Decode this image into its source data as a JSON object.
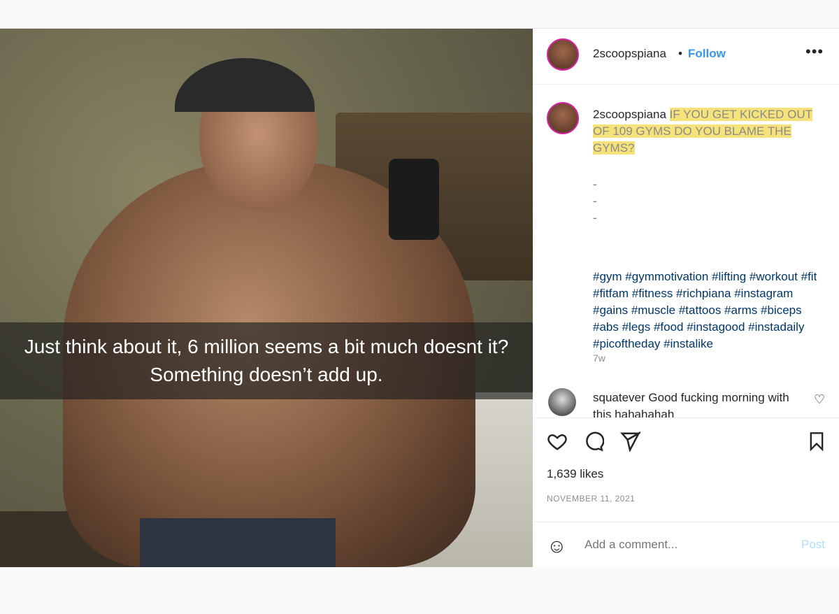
{
  "overlay": {
    "caption": "Just think about it, 6 million seems a bit much doesnt it? Something doesn’t add up."
  },
  "header": {
    "username": "2scoopspiana",
    "separator": "•",
    "follow_label": "Follow",
    "more_icon": "more-horizontal-icon"
  },
  "caption": {
    "username": "2scoopspiana",
    "text": "IF YOU GET KICKED OUT OF 109 GYMS DO YOU BLAME THE GYMS?",
    "dashes": [
      "-",
      "-",
      "-"
    ],
    "hashtags": "#gym #gymmotivation #lifting #workout #fit #fitfam #fitness #richpiana #instagram #gains #muscle #tattoos #arms #biceps #abs #legs #food #instagood #instadaily #picoftheday #instalike",
    "age": "7w"
  },
  "comment": {
    "username": "squatever",
    "text": "Good fucking morning with this hahahahah"
  },
  "actions": {
    "like_icon": "heart-icon",
    "comment_icon": "comment-icon",
    "share_icon": "send-icon",
    "save_icon": "bookmark-icon",
    "likes": "1,639 likes",
    "date": "NOVEMBER 11, 2021"
  },
  "add_comment": {
    "placeholder": "Add a comment...",
    "post_label": "Post"
  },
  "colors": {
    "accent": "#3897f0",
    "highlight": "#f6e27a",
    "hashtag": "#00376b",
    "muted": "#8e8e8e"
  }
}
